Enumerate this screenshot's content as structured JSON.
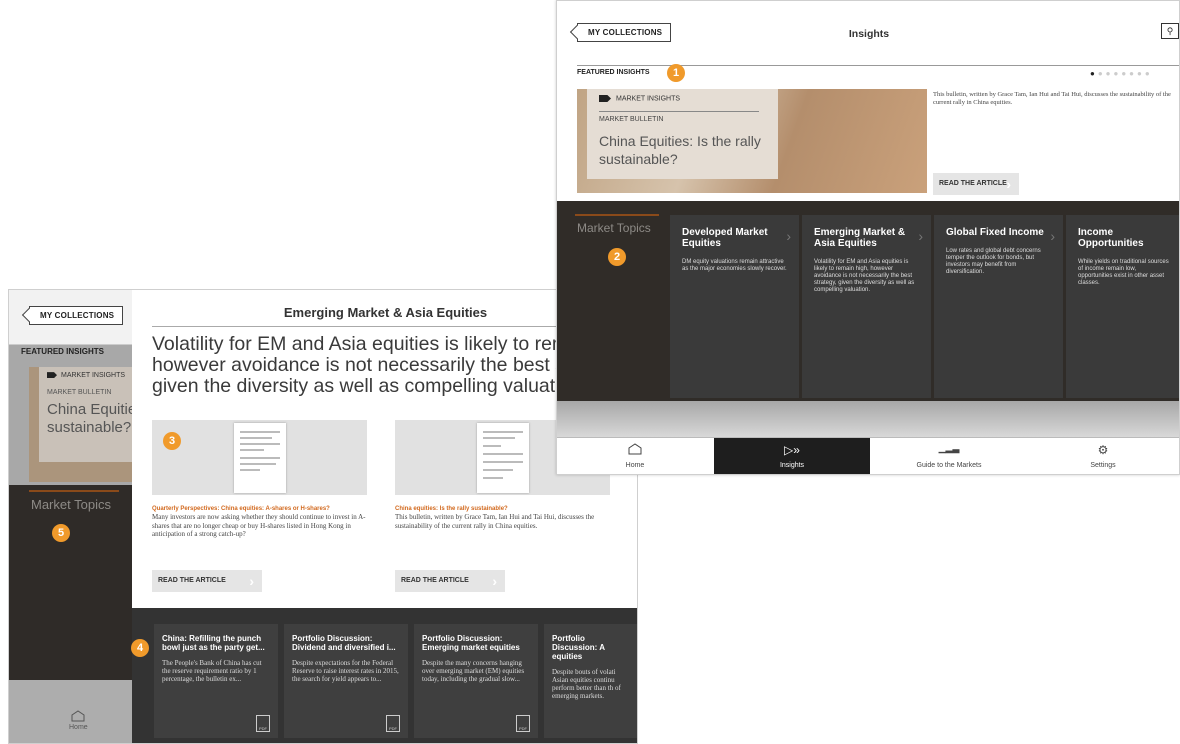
{
  "back": {
    "collections_label": "MY COLLECTIONS",
    "featured_label": "FEATURED INSIGHTS",
    "featured_tag": "MARKET INSIGHTS",
    "featured_sub": "MARKET BULLETIN",
    "featured_title_l1": "China Equities",
    "featured_title_l2": "sustainable?",
    "topics_head": "Market Topics",
    "home_label": "Home",
    "page_title": "Emerging Market & Asia Equities",
    "lead_l1": "Volatility for EM and Asia equities is likely to remain",
    "lead_l2": "however avoidance is not necessarily the best strate",
    "lead_l3": "given the diversity as well as compelling valuation.",
    "articles": [
      {
        "title": "Quarterly Perspectives: China equities: A-shares or H-shares?",
        "desc": "Many investors are now asking whether they should continue to invest in A-shares that are no longer cheap or buy H-shares listed in Hong Kong in anticipation of a strong catch-up?",
        "btn": "READ THE ARTICLE"
      },
      {
        "title": "China equities: Is the rally sustainable?",
        "desc": "This bulletin, written by Grace Tam, Ian Hui and Tai Hui, discusses the sustainability of the current rally in China equities.",
        "btn": "READ THE ARTICLE"
      }
    ],
    "papers": [
      {
        "title": "China: Refilling the punch bowl just as the party get...",
        "desc": "The People's Bank of China has cut the reserve requirement ratio by 1 percentage, the bulletin ex..."
      },
      {
        "title": "Portfolio Discussion: Dividend and diversified i...",
        "desc": "Despite expectations for the Federal Reserve to raise interest rates in 2015, the search for yield appears to..."
      },
      {
        "title": "Portfolio Discussion: Emerging market equities",
        "desc": "Despite the many concerns hanging over emerging market (EM) equities today, including the gradual slow..."
      },
      {
        "title": "Portfolio Discussion: A equities",
        "desc": "Despite bouts of volati Asian equities continu perform better than th of emerging markets."
      }
    ],
    "pdf_label": "PDF"
  },
  "front": {
    "collections_label": "MY COLLECTIONS",
    "page_title": "Insights",
    "featured_label": "FEATURED INSIGHTS",
    "featured_tag": "MARKET INSIGHTS",
    "featured_sub": "MARKET BULLETIN",
    "featured_title": "China Equities: Is the rally sustainable?",
    "featured_desc": "This bulletin, written by Grace Tam, Ian Hui and Tai Hui, discusses the sustainability of the current rally in China equities.",
    "read_btn": "READ THE ARTICLE",
    "topics_head": "Market Topics",
    "topics": [
      {
        "title": "Developed Market Equities",
        "desc": "DM equity valuations remain attractive as the major economies slowly recover."
      },
      {
        "title": "Emerging Market & Asia Equities",
        "desc": "Volatility for EM and Asia equities is likely to remain high, however avoidance is not necessarily the best strategy, given the diversity as well as compelling valuation."
      },
      {
        "title": "Global Fixed Income",
        "desc": "Low rates and global debt concerns temper the outlook for bonds, but investors may benefit from diversification."
      },
      {
        "title": "Income Opportunities",
        "desc": "While yields on traditional sources of income remain low, opportunities exist in other asset classes."
      }
    ],
    "nav": [
      {
        "label": "Home",
        "icon": "home-icon"
      },
      {
        "label": "Insights",
        "icon": "insights-icon"
      },
      {
        "label": "Guide to the Markets",
        "icon": "chart-icon"
      },
      {
        "label": "Settings",
        "icon": "gear-icon"
      }
    ]
  },
  "callouts": [
    "1",
    "2",
    "3",
    "4",
    "5"
  ],
  "colors": {
    "accent": "#f09a2b",
    "dark": "#302c28",
    "orange_text": "#d2691e"
  }
}
